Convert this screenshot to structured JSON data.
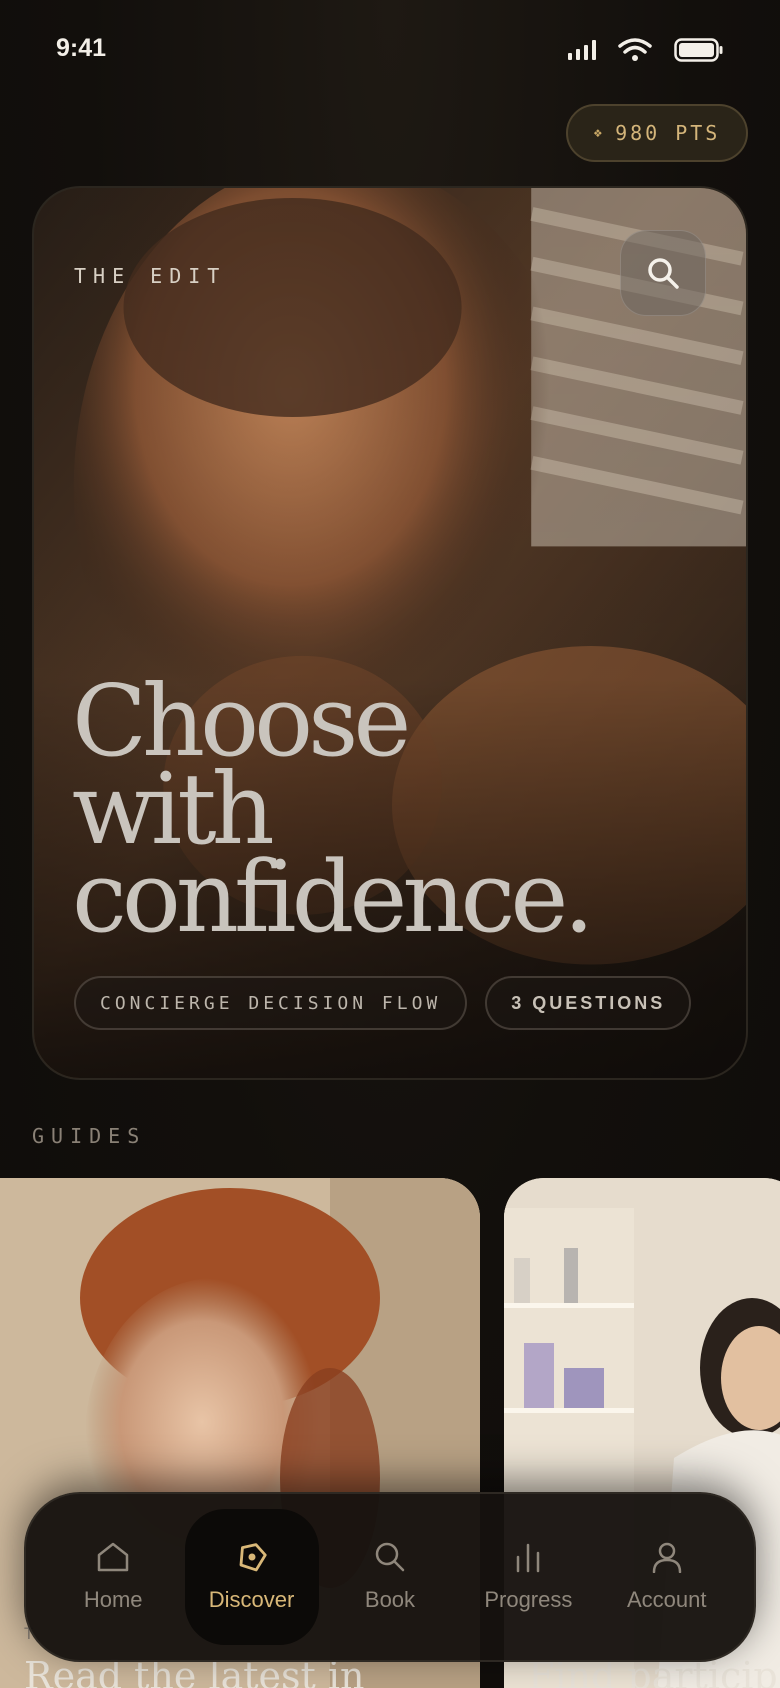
{
  "status_bar": {
    "time": "9:41"
  },
  "points": {
    "label": "980 PTS",
    "glyph": "❖"
  },
  "hero": {
    "eyebrow": "THE EDIT",
    "headline_lines": [
      "Choose",
      "with",
      "confidence."
    ],
    "chips": [
      "CONCIERGE DECISION FLOW",
      "3 QUESTIONS"
    ]
  },
  "guides": {
    "section_label": "GUIDES",
    "items": [
      {
        "kicker": "T",
        "title": "Read the latest in"
      },
      {
        "title": "Find particip"
      }
    ]
  },
  "tab_bar": {
    "tabs": [
      {
        "label": "Home",
        "icon": "home-icon",
        "active": false
      },
      {
        "label": "Discover",
        "icon": "compass-icon",
        "active": true
      },
      {
        "label": "Book",
        "icon": "search-icon",
        "active": false
      },
      {
        "label": "Progress",
        "icon": "bar-chart-icon",
        "active": false
      },
      {
        "label": "Account",
        "icon": "user-icon",
        "active": false
      }
    ]
  },
  "colors": {
    "background": "#120f0c",
    "accent_gold": "#d9b878",
    "muted_text": "#8f877c"
  }
}
